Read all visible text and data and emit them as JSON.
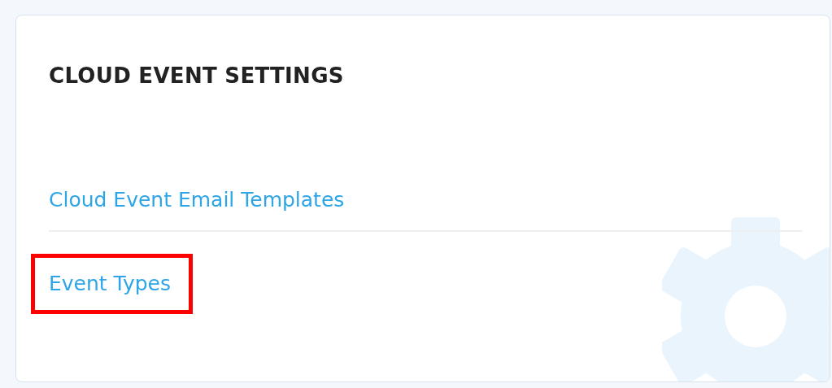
{
  "title": "CLOUD EVENT SETTINGS",
  "links": [
    {
      "label": "Cloud Event Email Templates",
      "highlighted": false
    },
    {
      "label": "Event Types",
      "highlighted": true
    }
  ]
}
